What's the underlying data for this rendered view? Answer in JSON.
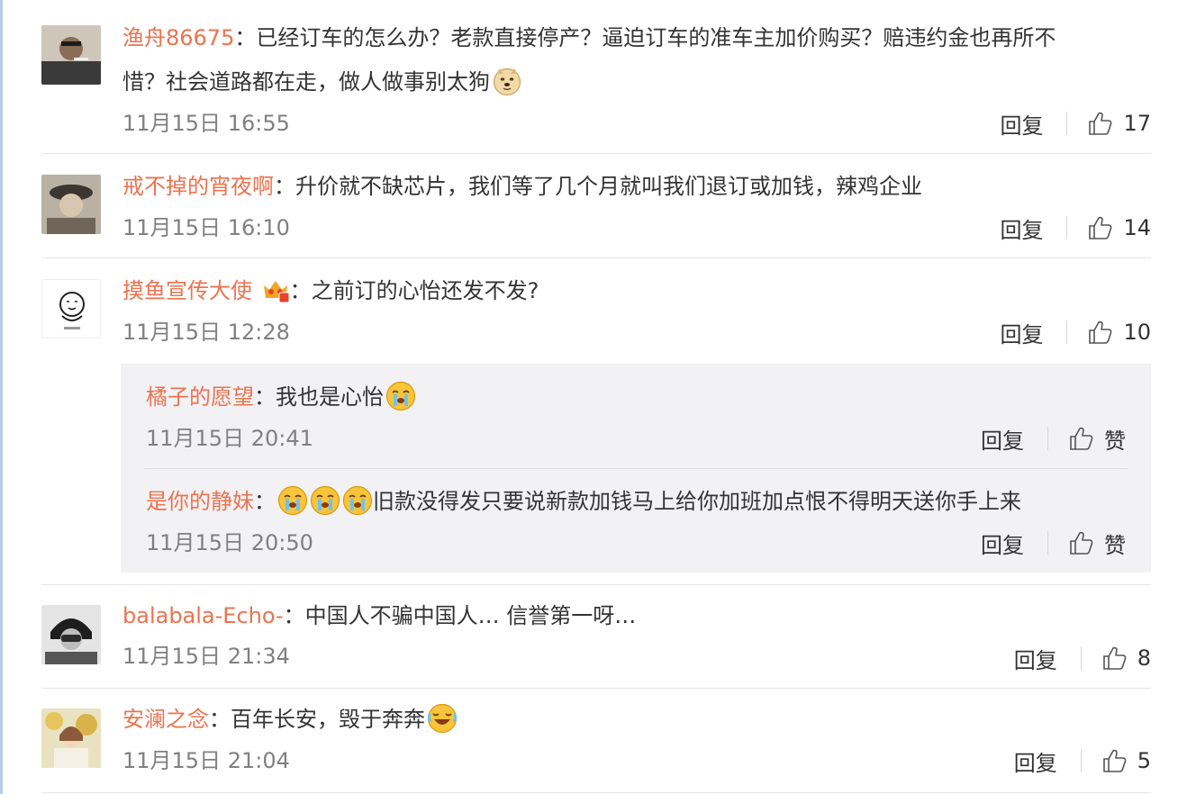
{
  "comments": [
    {
      "user": "渔舟86675",
      "sep": "：",
      "text": "已经订车的怎么办？老款直接停产？逼迫订车的准车主加价购买？赔违约金也再所不",
      "text2": "惜？社会道路都在走，做人做事别太狗",
      "emoji": "doge-emoji",
      "time": "11月15日 16:55",
      "reply": "回复",
      "likes": "17"
    },
    {
      "user": "戒不掉的宵夜啊",
      "sep": "：",
      "text": "升价就不缺芯片，我们等了几个月就叫我们退订或加钱，辣鸡企业",
      "time": "11月15日 16:10",
      "reply": "回复",
      "likes": "14"
    },
    {
      "user": "摸鱼宣传大使",
      "sep": "：",
      "text": "之前订的心怡还发不发?",
      "badge": "crown-badge-icon",
      "time": "11月15日 12:28",
      "reply": "回复",
      "likes": "10"
    },
    {
      "user": "balabala-Echo-",
      "sep": "：",
      "text": "中国人不骗中国人… 信誉第一呀…",
      "time": "11月15日 21:34",
      "reply": "回复",
      "likes": "8"
    },
    {
      "user": "安澜之念",
      "sep": "：",
      "text": "百年长安，毁于奔奔",
      "emoji": "laugh-cry-emoji",
      "time": "11月15日 21:04",
      "reply": "回复",
      "likes": "5"
    }
  ],
  "replies": [
    {
      "user": "橘子的愿望",
      "sep": "：",
      "text": "我也是心怡",
      "emoji": "crying-emoji",
      "time": "11月15日 20:41",
      "reply": "回复",
      "like_label": "赞"
    },
    {
      "user": "是你的静妹",
      "sep": "：",
      "text": "旧款没得发只要说新款加钱马上给你加班加点恨不得明天送你手上来",
      "emoji": "crying-emoji",
      "time": "11月15日 20:50",
      "reply": "回复",
      "like_label": "赞"
    }
  ],
  "colors": {
    "username": "#eb7350",
    "text": "#333333",
    "time": "#808080",
    "subbox": "#f2f2f5"
  }
}
